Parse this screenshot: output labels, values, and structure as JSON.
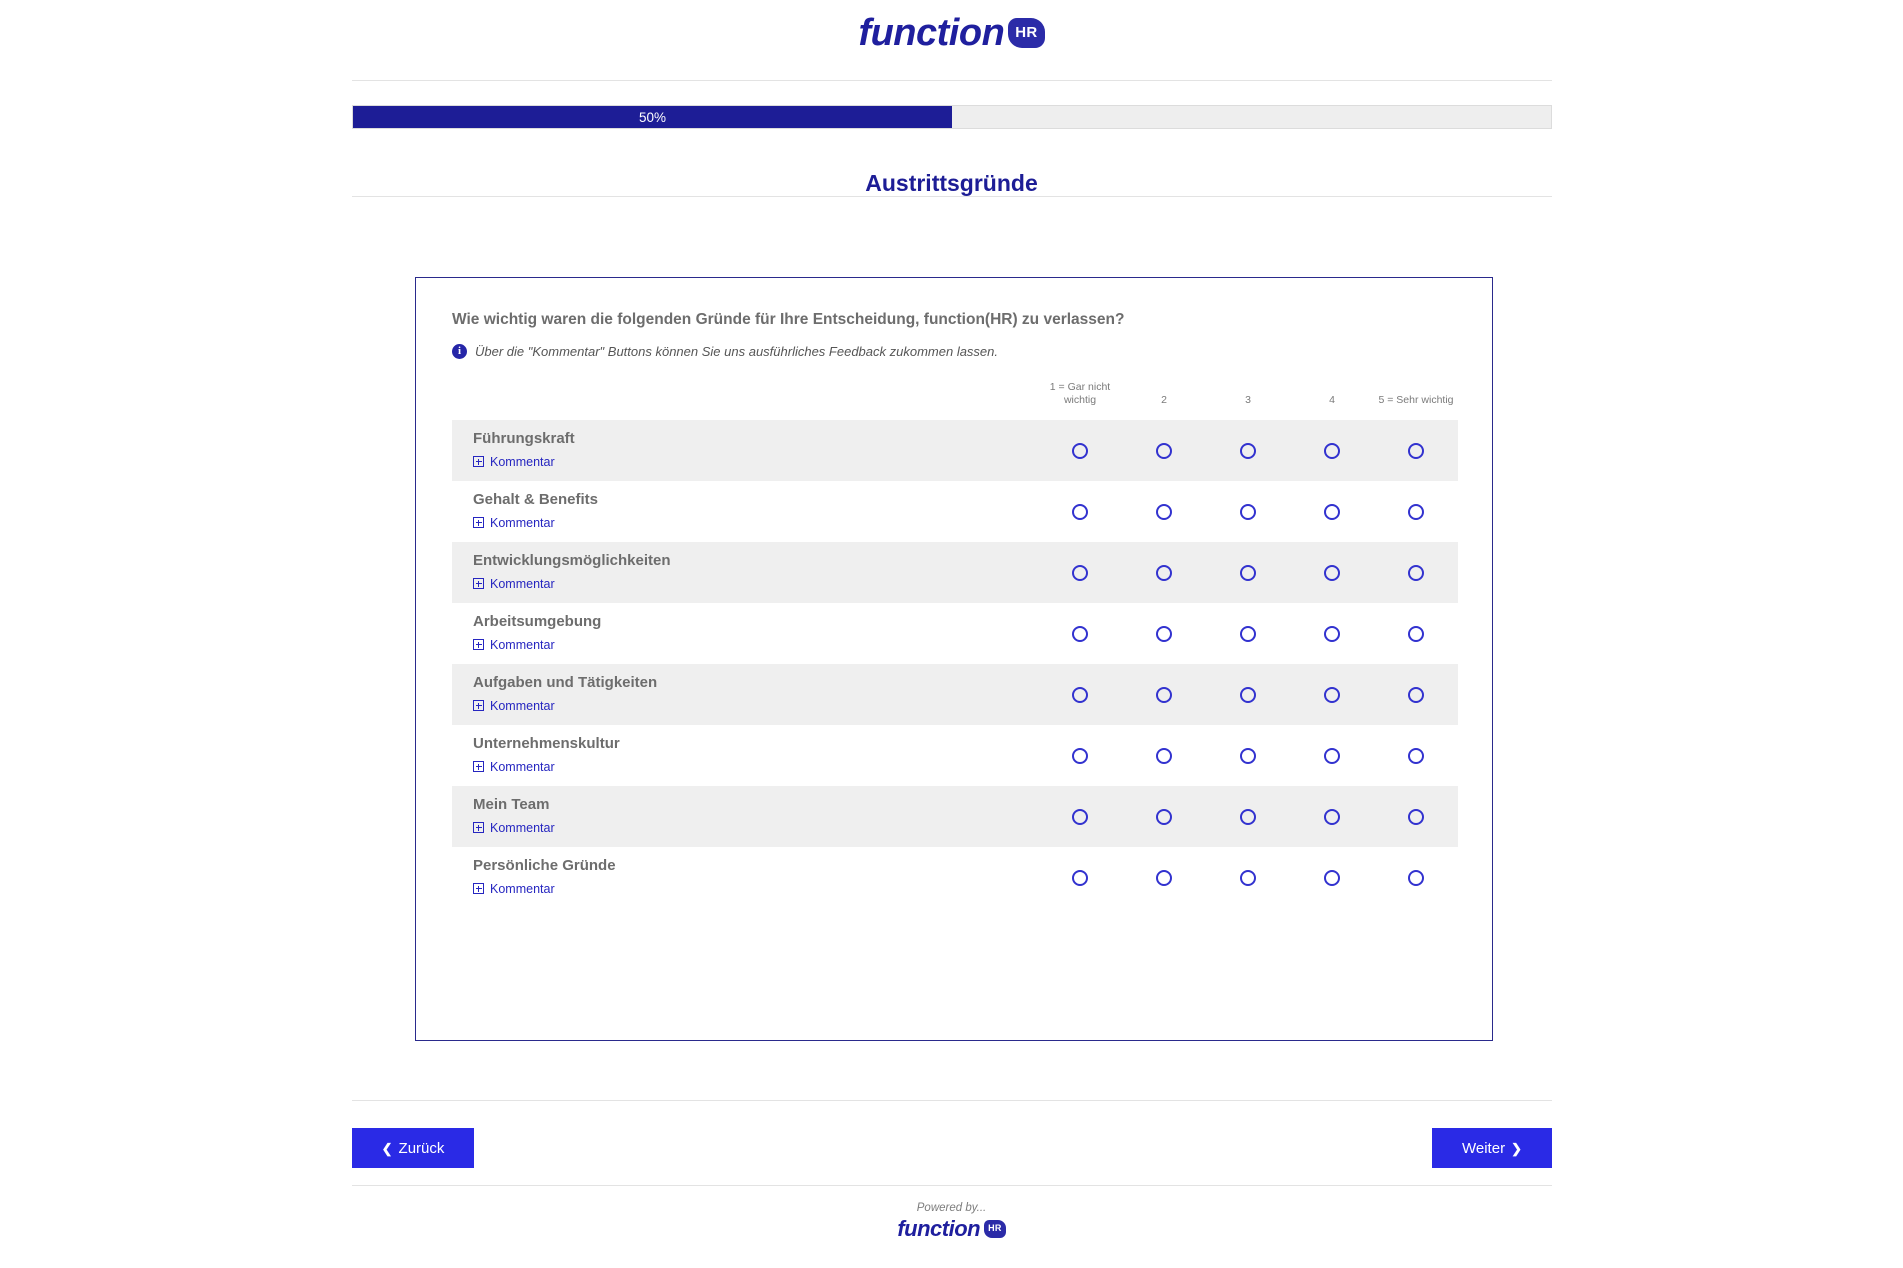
{
  "brand": {
    "wordmark": "function",
    "badge": "HR",
    "primary_color": "#1d1d96",
    "accent_color": "#2a2ae6"
  },
  "progress": {
    "percent_label": "50%",
    "percent_value": 50
  },
  "section": {
    "title": "Austrittsgründe"
  },
  "survey": {
    "question": "Wie wichtig waren die folgenden Gründe für Ihre Entscheidung, function(HR) zu verlassen?",
    "hint_icon": "info-icon",
    "hint": "Über die \"Kommentar\" Buttons können Sie uns ausführliches Feedback zukommen lassen.",
    "scale_headers": [
      "1 = Gar nicht wichtig",
      "2",
      "3",
      "4",
      "5 = Sehr wichtig"
    ],
    "comment_label": "Kommentar",
    "rows": [
      {
        "label": "Führungskraft"
      },
      {
        "label": "Gehalt & Benefits"
      },
      {
        "label": "Entwicklungsmöglichkeiten"
      },
      {
        "label": "Arbeitsumgebung"
      },
      {
        "label": "Aufgaben und Tätigkeiten"
      },
      {
        "label": "Unternehmenskultur"
      },
      {
        "label": "Mein Team"
      },
      {
        "label": "Persönliche Gründe"
      }
    ]
  },
  "navigation": {
    "back_label": "Zurück",
    "back_icon": "chevron-left-icon",
    "next_label": "Weiter",
    "next_icon": "chevron-right-icon"
  },
  "footer": {
    "powered_by": "Powered by..."
  }
}
